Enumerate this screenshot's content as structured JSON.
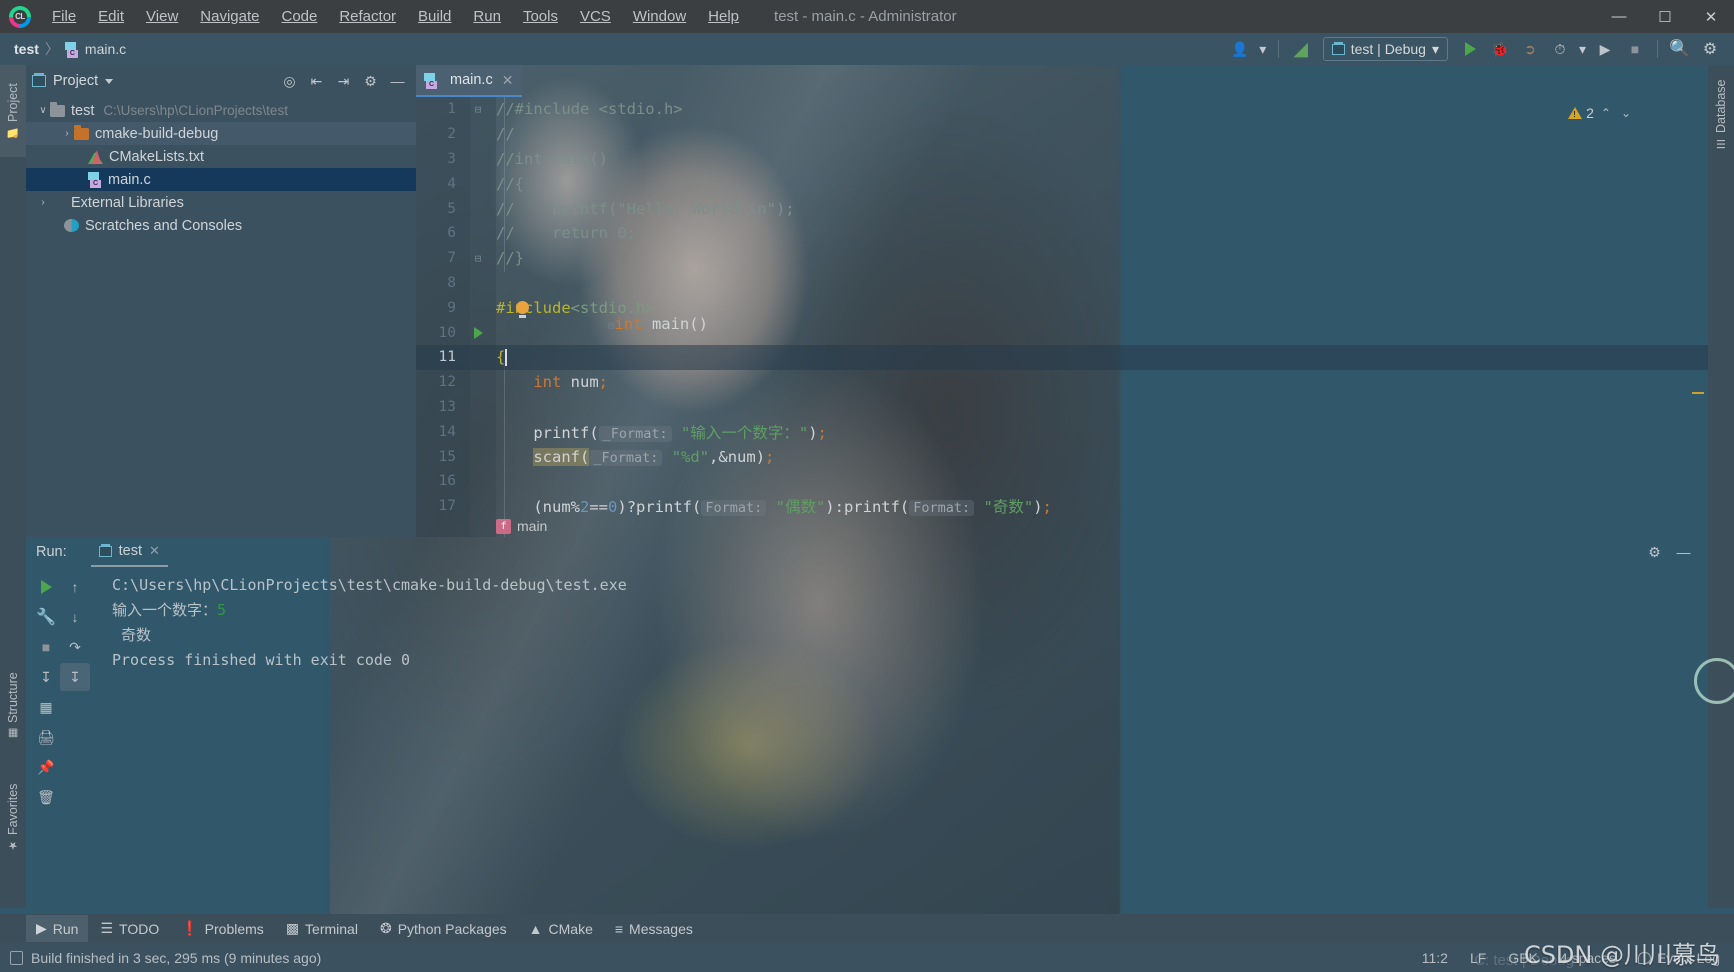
{
  "window": {
    "title": "test - main.c - Administrator",
    "logo_text": "CL",
    "controls": {
      "minimize": "—",
      "maximize": "☐",
      "close": "✕"
    }
  },
  "menubar": {
    "items": [
      {
        "label": "File",
        "mnemonic": "F"
      },
      {
        "label": "Edit",
        "mnemonic": "E"
      },
      {
        "label": "View",
        "mnemonic": "V"
      },
      {
        "label": "Navigate",
        "mnemonic": "N"
      },
      {
        "label": "Code",
        "mnemonic": "C"
      },
      {
        "label": "Refactor",
        "mnemonic": "R"
      },
      {
        "label": "Build",
        "mnemonic": "B"
      },
      {
        "label": "Run",
        "mnemonic": "R"
      },
      {
        "label": "Tools",
        "mnemonic": "T"
      },
      {
        "label": "VCS",
        "mnemonic": "S"
      },
      {
        "label": "Window",
        "mnemonic": "W"
      },
      {
        "label": "Help",
        "mnemonic": "H"
      }
    ]
  },
  "navbar": {
    "breadcrumb": {
      "project": "test",
      "separator": "〉",
      "file": "main.c"
    },
    "run_config": {
      "label": "test | Debug",
      "chevron": "▾"
    },
    "icons": {
      "user": "user-icon",
      "hammer": "build-icon",
      "run": "run-icon",
      "debug": "debug-icon",
      "attach": "attach-icon",
      "profile": "profile-icon",
      "coverage": "coverage-icon",
      "stop": "stop-icon",
      "search": "search-icon",
      "settings": "settings-icon"
    }
  },
  "left_strip": {
    "tabs": [
      {
        "label": "Project",
        "active": true
      },
      {
        "label": "Structure",
        "active": false
      },
      {
        "label": "Favorites",
        "active": false
      }
    ]
  },
  "right_strip": {
    "tabs": [
      {
        "label": "Database",
        "active": false
      }
    ]
  },
  "project_panel": {
    "title": "Project",
    "chevron": "▾",
    "actions": [
      "locate-icon",
      "expand-all-icon",
      "collapse-all-icon",
      "gear-icon",
      "hide-icon"
    ],
    "tree": [
      {
        "arrow": "∨",
        "label": "test",
        "path": "C:\\Users\\hp\\CLionProjects\\test",
        "indent": 0,
        "icon": "folder",
        "state": "normal"
      },
      {
        "arrow": "›",
        "label": "cmake-build-debug",
        "path": "",
        "indent": 1,
        "icon": "folder-orange",
        "state": "hover"
      },
      {
        "arrow": "",
        "label": "CMakeLists.txt",
        "path": "",
        "indent": 2,
        "icon": "cmake",
        "state": "normal"
      },
      {
        "arrow": "",
        "label": "main.c",
        "path": "",
        "indent": 2,
        "icon": "c-file",
        "state": "selected"
      },
      {
        "arrow": "›",
        "label": "External Libraries",
        "path": "",
        "indent": 0,
        "icon": "library",
        "state": "normal"
      },
      {
        "arrow": "",
        "label": "Scratches and Consoles",
        "path": "",
        "indent": 0,
        "icon": "scratch",
        "state": "normal"
      }
    ]
  },
  "editor": {
    "tab": {
      "label": "main.c",
      "close": "✕"
    },
    "inspection": {
      "count": "2",
      "up": "⌃",
      "down": "⌄"
    },
    "breadcrumb": {
      "badge": "f",
      "label": "main"
    },
    "lines": [
      {
        "n": "1",
        "fold": "⊟",
        "run": false,
        "tokens": [
          {
            "t": "//#include <stdio.h>",
            "c": "c-comment"
          }
        ],
        "indent": 0
      },
      {
        "n": "2",
        "fold": "",
        "run": false,
        "tokens": [
          {
            "t": "//",
            "c": "c-comment"
          }
        ],
        "indent": 0
      },
      {
        "n": "3",
        "fold": "",
        "run": false,
        "tokens": [
          {
            "t": "//int main()",
            "c": "c-comment"
          }
        ],
        "indent": 0
      },
      {
        "n": "4",
        "fold": "",
        "run": false,
        "tokens": [
          {
            "t": "//{",
            "c": "c-comment"
          }
        ],
        "indent": 0
      },
      {
        "n": "5",
        "fold": "",
        "run": false,
        "tokens": [
          {
            "t": "//    printf(\"Hello, World!\\n\");",
            "c": "c-comment"
          }
        ],
        "indent": 0
      },
      {
        "n": "6",
        "fold": "",
        "run": false,
        "tokens": [
          {
            "t": "//    return 0;",
            "c": "c-comment"
          }
        ],
        "indent": 0
      },
      {
        "n": "7",
        "fold": "⊟",
        "run": false,
        "tokens": [
          {
            "t": "//}",
            "c": "c-comment"
          }
        ],
        "indent": 0
      },
      {
        "n": "8",
        "fold": "",
        "run": false,
        "tokens": [],
        "indent": 0
      },
      {
        "n": "9",
        "fold": "",
        "run": false,
        "tokens": [
          {
            "t": "#include",
            "c": "c-inc"
          },
          {
            "t": "<stdio.h>",
            "c": "c-hdr"
          }
        ],
        "indent": 0
      },
      {
        "n": "10",
        "fold": "⊟",
        "run": true,
        "tokens": [
          {
            "t": "int",
            "c": "c-kw"
          },
          {
            "t": " main()",
            "c": "c-plain"
          }
        ],
        "indent": 0
      },
      {
        "n": "11",
        "fold": "",
        "run": false,
        "current": true,
        "tokens": [
          {
            "t": "{",
            "c": "c-inc"
          }
        ],
        "indent": 0
      },
      {
        "n": "12",
        "fold": "",
        "run": false,
        "tokens": [
          {
            "t": "    ",
            "c": "c-plain"
          },
          {
            "t": "int",
            "c": "c-kw"
          },
          {
            "t": " num",
            "c": "c-plain"
          },
          {
            "t": ";",
            "c": "c-semi"
          }
        ],
        "indent": 0
      },
      {
        "n": "13",
        "fold": "",
        "run": false,
        "tokens": [],
        "indent": 0
      },
      {
        "n": "14",
        "fold": "",
        "run": false,
        "tokens": [
          {
            "t": "    printf(",
            "c": "c-plain"
          },
          {
            "t": "_Format:",
            "c": "hint"
          },
          {
            "t": " ",
            "c": "c-plain"
          },
          {
            "t": "\"输入一个数字：\"",
            "c": "c-str"
          },
          {
            "t": ")",
            "c": "c-plain"
          },
          {
            "t": ";",
            "c": "c-semi"
          }
        ],
        "indent": 0
      },
      {
        "n": "15",
        "fold": "",
        "run": false,
        "tokens": [
          {
            "t": "    ",
            "c": "c-plain"
          },
          {
            "t": "scanf(",
            "c": "hl-yellow"
          },
          {
            "t": "_Format:",
            "c": "hint"
          },
          {
            "t": " ",
            "c": "c-plain"
          },
          {
            "t": "\"%d\"",
            "c": "c-str"
          },
          {
            "t": ",&num)",
            "c": "c-plain"
          },
          {
            "t": ";",
            "c": "c-semi"
          }
        ],
        "indent": 0
      },
      {
        "n": "16",
        "fold": "",
        "run": false,
        "tokens": [],
        "indent": 0
      },
      {
        "n": "17",
        "fold": "",
        "run": false,
        "tokens": [
          {
            "t": "    (num%",
            "c": "c-plain"
          },
          {
            "t": "2",
            "c": "c-num"
          },
          {
            "t": "==",
            "c": "c-plain"
          },
          {
            "t": "0",
            "c": "c-num"
          },
          {
            "t": ")?printf(",
            "c": "c-plain"
          },
          {
            "t": "Format:",
            "c": "hint"
          },
          {
            "t": " ",
            "c": "c-plain"
          },
          {
            "t": "\"偶数\"",
            "c": "c-str"
          },
          {
            "t": "):printf(",
            "c": "c-plain"
          },
          {
            "t": "Format:",
            "c": "hint"
          },
          {
            "t": " ",
            "c": "c-plain"
          },
          {
            "t": "\"奇数\"",
            "c": "c-str"
          },
          {
            "t": ")",
            "c": "c-plain"
          },
          {
            "t": ";",
            "c": "c-semi"
          }
        ],
        "indent": 0
      }
    ]
  },
  "run_panel": {
    "label": "Run:",
    "tab": {
      "label": "test",
      "close": "✕"
    },
    "header_actions": [
      "gear-icon",
      "hide-icon"
    ],
    "tool_buttons": [
      "rerun-icon",
      "wrench-icon",
      "stop-icon",
      "up-icon",
      "down-icon",
      "soft-wrap-icon",
      "scroll-end-icon",
      "print-icon",
      "trash-icon"
    ],
    "console": [
      {
        "text": "C:\\Users\\hp\\CLionProjects\\test\\cmake-build-debug\\test.exe",
        "green": ""
      },
      {
        "text": "输入一个数字：",
        "green": "5"
      },
      {
        "text": " 奇数",
        "green": ""
      },
      {
        "text": "Process finished with exit code 0",
        "green": ""
      }
    ]
  },
  "bottom_tabs": [
    {
      "label": "Run",
      "icon": "run-icon",
      "active": true
    },
    {
      "label": "TODO",
      "icon": "todo-icon",
      "active": false
    },
    {
      "label": "Problems",
      "icon": "problems-icon",
      "active": false
    },
    {
      "label": "Terminal",
      "icon": "terminal-icon",
      "active": false
    },
    {
      "label": "Python Packages",
      "icon": "python-icon",
      "active": false
    },
    {
      "label": "CMake",
      "icon": "cmake-icon",
      "active": false
    },
    {
      "label": "Messages",
      "icon": "messages-icon",
      "active": false
    }
  ],
  "statusbar": {
    "build_message": "Build finished in 3 sec, 295 ms (9 minutes ago)",
    "caret_position": "11:2",
    "line_separator": "LF",
    "encoding": "GBK",
    "indent": "4 spaces",
    "event_log": "Event Log",
    "ghost_config": "C: test | Debug"
  },
  "watermark": {
    "text": "CSDN @川川慕鸟"
  },
  "colors": {
    "accent_blue": "#4a88c7",
    "panel_bg": "#3c5160",
    "toolbar_bg": "#3b5463",
    "selection": "#15395b",
    "green_run": "#4ca64c",
    "string_green": "#5f9e63",
    "keyword_orange": "#cc7832",
    "number_blue": "#6897bb",
    "include_yellow": "#bbb529",
    "warn_yellow": "#d6a427"
  }
}
